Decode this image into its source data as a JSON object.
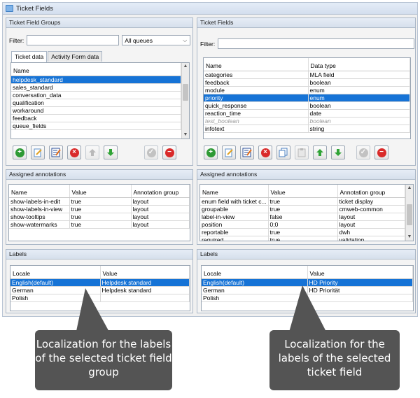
{
  "window": {
    "title": "Ticket Fields"
  },
  "left": {
    "groups_panel": {
      "title": "Ticket Field Groups",
      "filter_label": "Filter:",
      "filter_value": "",
      "queue_select": "All queues",
      "tabs": [
        "Ticket data",
        "Activity Form data"
      ],
      "column": "Name",
      "rows": [
        "helpdesk_standard",
        "sales_standard",
        "conversation_data",
        "qualification",
        "workaround",
        "feedback",
        "queue_fields"
      ],
      "selected_index": 0
    },
    "annotations": {
      "title": "Assigned annotations",
      "columns": [
        "Name",
        "Value",
        "Annotation group"
      ],
      "rows": [
        [
          "show-labels-in-edit",
          "true",
          "layout"
        ],
        [
          "show-labels-in-view",
          "true",
          "layout"
        ],
        [
          "show-tooltips",
          "true",
          "layout"
        ],
        [
          "show-watermarks",
          "true",
          "layout"
        ]
      ]
    },
    "labels": {
      "title": "Labels",
      "columns": [
        "Locale",
        "Value"
      ],
      "rows": [
        [
          "English(default)",
          "Helpdesk standard"
        ],
        [
          "German",
          "Helpdesk standard"
        ],
        [
          "Polish",
          ""
        ]
      ],
      "selected_index": 0
    }
  },
  "right": {
    "fields_panel": {
      "title": "Ticket Fields",
      "filter_label": "Filter:",
      "filter_value": "",
      "columns": [
        "Name",
        "Data type"
      ],
      "rows": [
        [
          "categories",
          "MLA field"
        ],
        [
          "feedback",
          "boolean"
        ],
        [
          "module",
          "enum"
        ],
        [
          "priority",
          "enum"
        ],
        [
          "quick_response",
          "boolean"
        ],
        [
          "reaction_time",
          "date"
        ],
        [
          "test_boolean",
          "boolean"
        ],
        [
          "infotext",
          "string"
        ]
      ],
      "selected_index": 3,
      "disabled_index": 6
    },
    "annotations": {
      "title": "Assigned annotations",
      "columns": [
        "Name",
        "Value",
        "Annotation group"
      ],
      "rows": [
        [
          "enum field with ticket c...",
          "true",
          "ticket display"
        ],
        [
          "groupable",
          "true",
          "cmweb-common"
        ],
        [
          "label-in-view",
          "false",
          "layout"
        ],
        [
          "position",
          "0;0",
          "layout"
        ],
        [
          "reportable",
          "true",
          "dwh"
        ],
        [
          "required",
          "true",
          "validation"
        ]
      ]
    },
    "labels": {
      "title": "Labels",
      "columns": [
        "Locale",
        "Value"
      ],
      "rows": [
        [
          "English(default)",
          "HD Priority"
        ],
        [
          "German",
          "HD Priorität"
        ],
        [
          "Polish",
          ""
        ]
      ],
      "selected_index": 0
    }
  },
  "callouts": {
    "left": "Localization for the labels of the selected ticket field group",
    "right": "Localization for the labels of the selected ticket field"
  },
  "colors": {
    "selection": "#1673d6",
    "callout": "#545454",
    "add": "#2e9a35",
    "delete": "#d92a2a",
    "move": "#2fa336"
  }
}
